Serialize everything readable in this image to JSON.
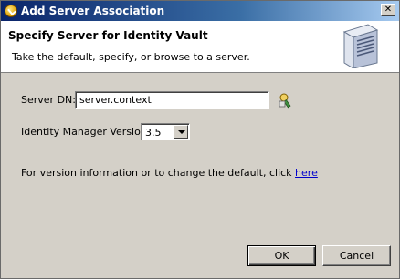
{
  "window": {
    "title": "Add Server Association",
    "close_label": "✕"
  },
  "header": {
    "title": "Specify Server for Identity Vault",
    "description": "Take the default, specify, or browse to a server."
  },
  "form": {
    "server_dn_label": "Server DN:",
    "server_dn_value": "server.context",
    "idm_version_label": "Identity Manager Version:",
    "idm_version_value": "3.5",
    "info_text": "For version information or to change the default, click ",
    "info_link": "here"
  },
  "buttons": {
    "ok": "OK",
    "cancel": "Cancel"
  },
  "colors": {
    "titlebar_start": "#0a246a",
    "link": "#0000cc",
    "dialog_bg": "#d4d0c8"
  }
}
